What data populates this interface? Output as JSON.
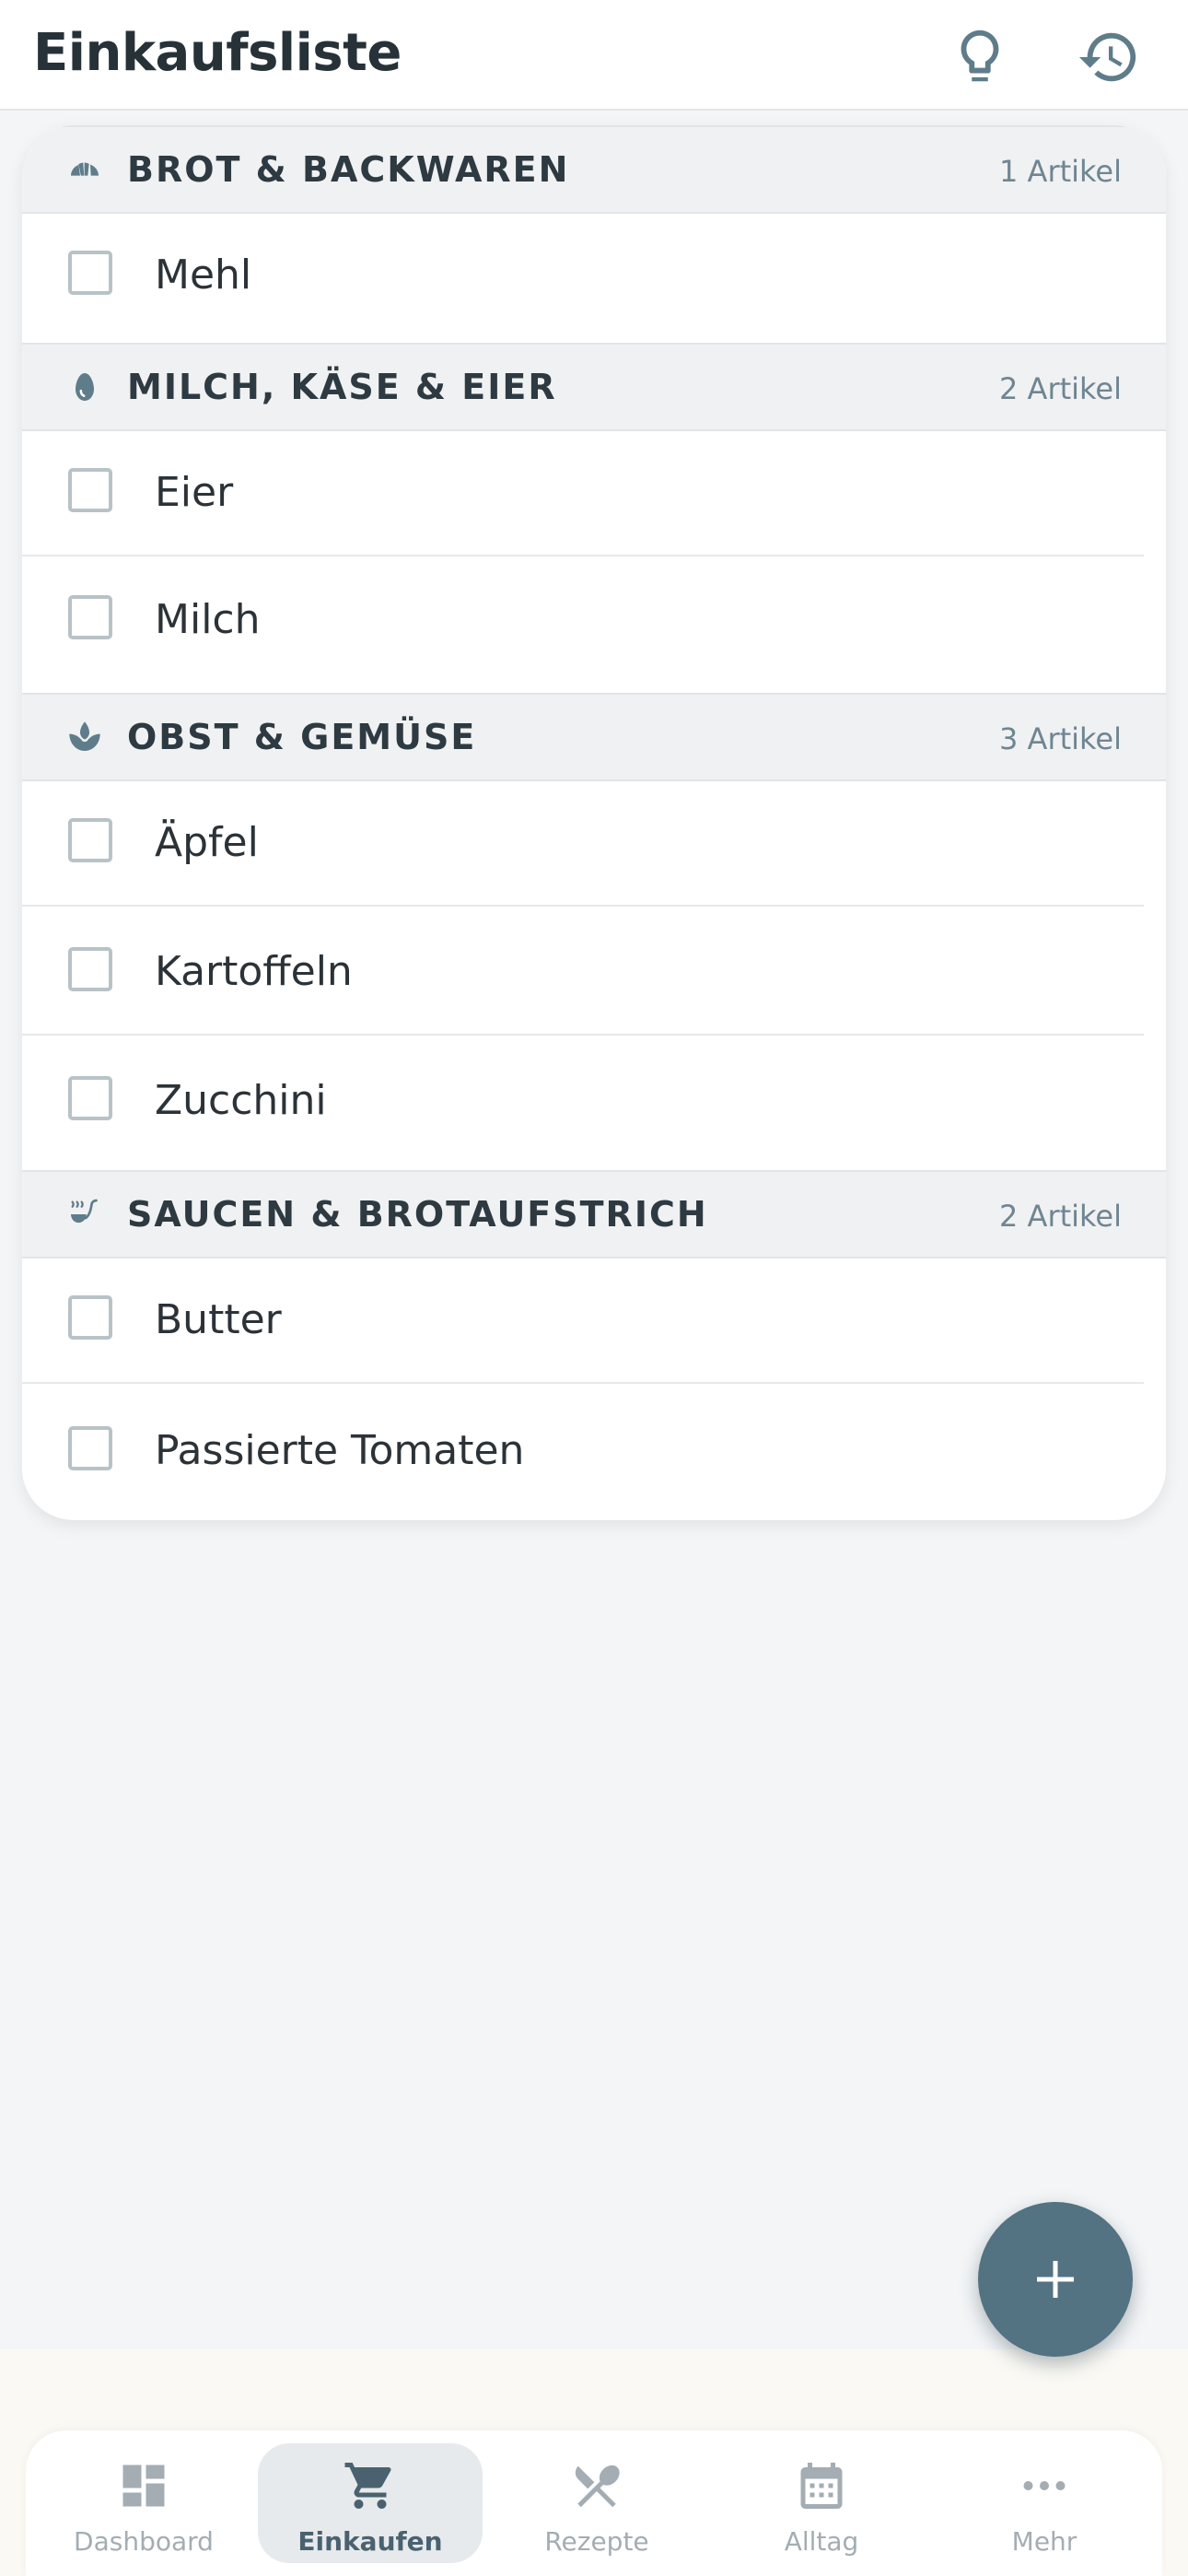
{
  "header": {
    "title": "Einkaufsliste"
  },
  "sections": [
    {
      "title": "BROT & BACKWAREN",
      "count": "1 Artikel",
      "icon": "bread-icon",
      "items": [
        "Mehl"
      ]
    },
    {
      "title": "MILCH, KÄSE & EIER",
      "count": "2 Artikel",
      "icon": "egg-icon",
      "items": [
        "Eier",
        "Milch"
      ]
    },
    {
      "title": "OBST & GEMÜSE",
      "count": "3 Artikel",
      "icon": "leaf-icon",
      "items": [
        "Äpfel",
        "Kartoffeln",
        "Zucchini"
      ]
    },
    {
      "title": "SAUCEN & BROTAUFSTRICH",
      "count": "2 Artikel",
      "icon": "ladle-icon",
      "items": [
        "Butter",
        "Passierte Tomaten"
      ]
    }
  ],
  "nav": [
    {
      "label": "Dashboard",
      "icon": "dashboard-icon"
    },
    {
      "label": "Einkaufen",
      "icon": "cart-icon"
    },
    {
      "label": "Rezepte",
      "icon": "cutlery-icon"
    },
    {
      "label": "Alltag",
      "icon": "calendar-icon"
    },
    {
      "label": "Mehr",
      "icon": "more-icon"
    }
  ],
  "colors": {
    "accent": "#537282",
    "icon": "#5f7c8a",
    "nav_inactive": "#a3adb3"
  }
}
